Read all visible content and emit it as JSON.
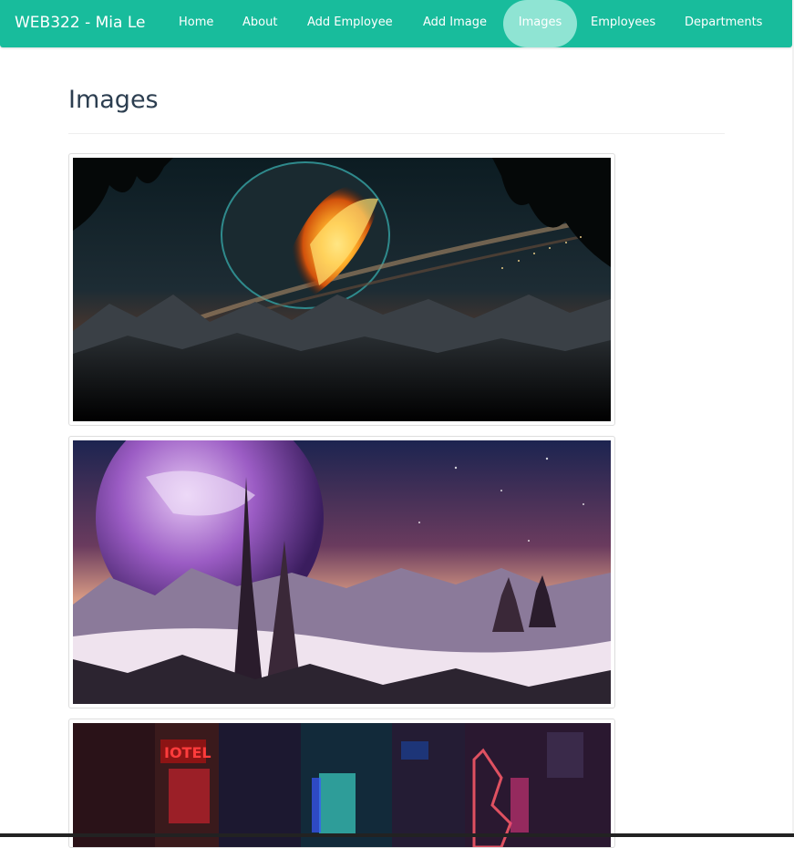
{
  "navbar": {
    "brand": "WEB322 - Mia Le",
    "items": [
      {
        "label": "Home",
        "active": false
      },
      {
        "label": "About",
        "active": false
      },
      {
        "label": "Add Employee",
        "active": false
      },
      {
        "label": "Add Image",
        "active": false
      },
      {
        "label": "Images",
        "active": true
      },
      {
        "label": "Employees",
        "active": false
      },
      {
        "label": "Departments",
        "active": false
      }
    ],
    "color": "#18bc9c",
    "active_color": "#8fe4d3"
  },
  "main": {
    "title": "Images"
  },
  "gallery": {
    "images": [
      {
        "subject": "orange-ring-planet-night-mountains"
      },
      {
        "subject": "purple-planet-alien-spires"
      },
      {
        "subject": "neon-city-street-hotel-sign",
        "sign_text": "IOTEL"
      }
    ]
  }
}
